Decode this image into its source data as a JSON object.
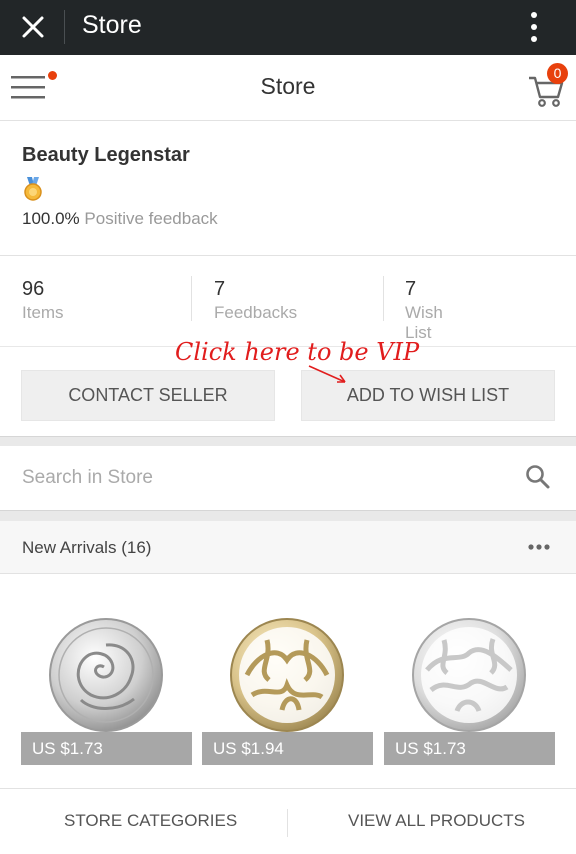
{
  "window": {
    "title": "Store",
    "close_icon": "close-icon",
    "menu_icon": "overflow-menu-icon"
  },
  "appbar": {
    "title": "Store",
    "cart_count": "0",
    "menu_icon": "hamburger-icon",
    "cart_icon": "cart-icon",
    "accent": "#e8400c"
  },
  "seller": {
    "name": "Beauty Legenstar",
    "medal_icon": "medal-icon",
    "feedback_value": "100.0%",
    "feedback_label": "Positive feedback"
  },
  "stats": [
    {
      "value": "96",
      "label": "Items"
    },
    {
      "value": "7",
      "label": "Feedbacks"
    },
    {
      "value": "7",
      "label": "Wish List"
    }
  ],
  "annotation": {
    "text": "Click here to be VIP",
    "color": "#e11d1d"
  },
  "actions": {
    "contact": "CONTACT SELLER",
    "wishlist": "ADD TO WISH LIST"
  },
  "search": {
    "placeholder": "Search in Store",
    "icon": "search-icon"
  },
  "new_arrivals": {
    "label": "New Arrivals",
    "count": "(16)",
    "more_icon": "more-icon"
  },
  "products": [
    {
      "price": "US $1.73",
      "image": "rose-coin-image"
    },
    {
      "price": "US $1.94",
      "image": "gold-filigree-coin-image"
    },
    {
      "price": "US $1.73",
      "image": "silver-filigree-coin-image"
    }
  ],
  "bottom": {
    "categories": "STORE CATEGORIES",
    "all_products": "VIEW ALL PRODUCTS"
  }
}
